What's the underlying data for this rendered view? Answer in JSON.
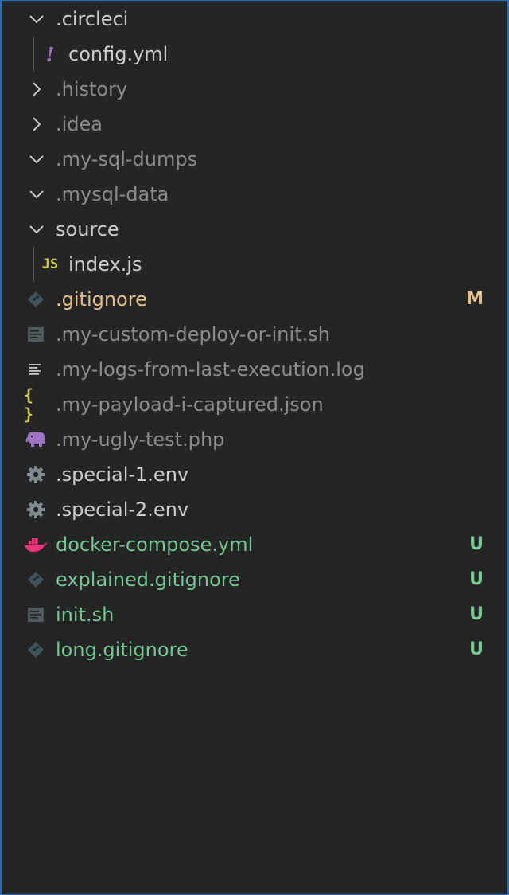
{
  "tree": {
    "items": [
      {
        "label": ".circleci",
        "kind": "folder",
        "expanded": true,
        "color": "white"
      },
      {
        "label": "config.yml",
        "kind": "file",
        "icon": "yaml-exclamation-icon",
        "color": "white"
      },
      {
        "label": ".history",
        "kind": "folder",
        "expanded": false,
        "color": "dim"
      },
      {
        "label": ".idea",
        "kind": "folder",
        "expanded": false,
        "color": "dim"
      },
      {
        "label": ".my-sql-dumps",
        "kind": "folder",
        "expanded": true,
        "color": "dim"
      },
      {
        "label": ".mysql-data",
        "kind": "folder",
        "expanded": true,
        "color": "dim"
      },
      {
        "label": "source",
        "kind": "folder",
        "expanded": true,
        "color": "white"
      },
      {
        "label": "index.js",
        "kind": "file",
        "icon": "javascript-icon",
        "color": "white"
      },
      {
        "label": ".gitignore",
        "kind": "file",
        "icon": "git-icon",
        "color": "orange",
        "badge": "M"
      },
      {
        "label": ".my-custom-deploy-or-init.sh",
        "kind": "file",
        "icon": "shell-script-icon",
        "color": "dim"
      },
      {
        "label": ".my-logs-from-last-execution.log",
        "kind": "file",
        "icon": "log-lines-icon",
        "color": "dim"
      },
      {
        "label": ".my-payload-i-captured.json",
        "kind": "file",
        "icon": "json-braces-icon",
        "color": "dim"
      },
      {
        "label": ".my-ugly-test.php",
        "kind": "file",
        "icon": "php-elephant-icon",
        "color": "dim"
      },
      {
        "label": ".special-1.env",
        "kind": "file",
        "icon": "gear-icon",
        "color": "white"
      },
      {
        "label": ".special-2.env",
        "kind": "file",
        "icon": "gear-icon",
        "color": "white"
      },
      {
        "label": "docker-compose.yml",
        "kind": "file",
        "icon": "docker-whale-icon",
        "color": "green",
        "badge": "U"
      },
      {
        "label": "explained.gitignore",
        "kind": "file",
        "icon": "git-icon",
        "color": "green",
        "badge": "U"
      },
      {
        "label": "init.sh",
        "kind": "file",
        "icon": "shell-script-icon",
        "color": "green",
        "badge": "U"
      },
      {
        "label": "long.gitignore",
        "kind": "file",
        "icon": "git-icon",
        "color": "green",
        "badge": "U"
      }
    ]
  },
  "icons": {
    "js_text": "JS",
    "yaml_text": "!",
    "json_text": "{ }"
  },
  "colors": {
    "background": "#252526",
    "border_accent": "#1f6fc9",
    "text_default": "#cccccc",
    "text_ignored": "#8c8c8c",
    "modified": "#e2c08d",
    "untracked": "#73c991",
    "git_icon": "#41535b",
    "js_icon": "#cbcb41",
    "yaml_icon": "#a074c4",
    "docker_icon": "#e7357a",
    "php_icon": "#a074c4"
  }
}
